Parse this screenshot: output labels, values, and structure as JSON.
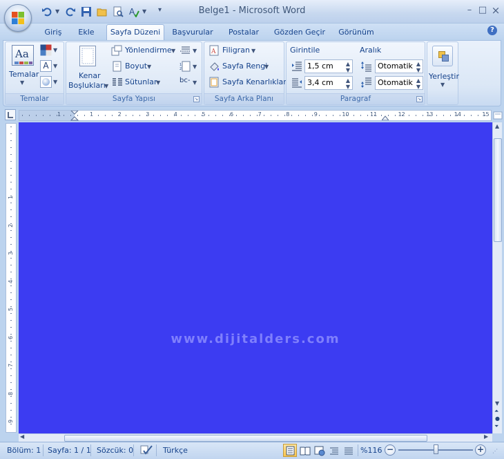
{
  "window": {
    "title": "Belge1 - Microsoft Word",
    "controls": {
      "minimize": "–",
      "maximize": "□",
      "close": "×"
    }
  },
  "tabs": [
    {
      "label": "Giriş",
      "active": false
    },
    {
      "label": "Ekle",
      "active": false
    },
    {
      "label": "Sayfa Düzeni",
      "active": true
    },
    {
      "label": "Başvurular",
      "active": false
    },
    {
      "label": "Postalar",
      "active": false
    },
    {
      "label": "Gözden Geçir",
      "active": false
    },
    {
      "label": "Görünüm",
      "active": false
    }
  ],
  "help": "?",
  "ribbon": {
    "temalar": {
      "group_label": "Temalar",
      "themes_label": "Temalar",
      "theme_icon_text": "Aa",
      "font_icon_text": "A"
    },
    "sayfa_yapisi": {
      "group_label": "Sayfa Yapısı",
      "margins_label_1": "Kenar",
      "margins_label_2": "Boşlukları",
      "orientation": "Yönlendirme",
      "size": "Boyut",
      "columns": "Sütunlar",
      "hyphen_icon_text": "bc-"
    },
    "sayfa_arka_plani": {
      "group_label": "Sayfa Arka Planı",
      "watermark": "Filigran",
      "page_color": "Sayfa Rengi",
      "page_borders": "Sayfa Kenarlıkları"
    },
    "paragraf": {
      "group_label": "Paragraf",
      "indent_label": "Girintile",
      "spacing_label": "Aralık",
      "indent_left": "1,5 cm",
      "indent_right": "3,4 cm",
      "spacing_before": "Otomatik",
      "spacing_after": "Otomatik"
    },
    "yerlestir": {
      "label": "Yerleştir"
    }
  },
  "ruler": {
    "h_ticks": [
      "1",
      "1",
      "2",
      "3",
      "4",
      "5",
      "6",
      "7",
      "8",
      "9",
      "10",
      "11",
      "12",
      "13",
      "14",
      "15"
    ],
    "v_ticks": [
      "1",
      "2",
      "3",
      "4",
      "5",
      "6",
      "7",
      "8",
      "9"
    ]
  },
  "document": {
    "background_color": "#3c3cf2",
    "watermark_text": "www.dijitalders.com"
  },
  "status": {
    "section": "Bölüm: 1",
    "page": "Sayfa: 1 / 1",
    "words": "Sözcük: 0",
    "language": "Türkçe",
    "zoom": "%116"
  }
}
